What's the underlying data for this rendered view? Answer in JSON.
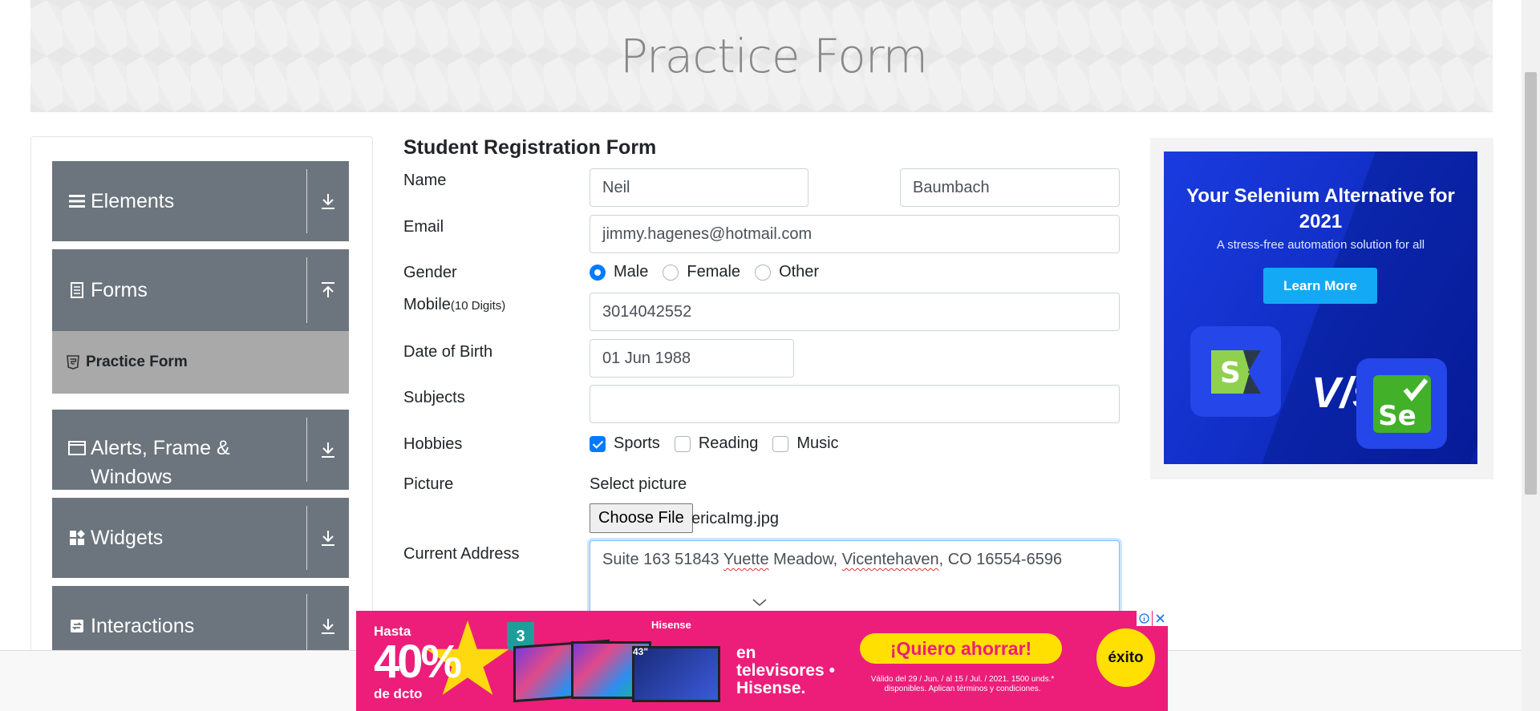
{
  "header": {
    "title": "Practice Form"
  },
  "sidebar": {
    "groups": [
      {
        "label": "Elements",
        "icon": "hamburger-icon",
        "arrow": "download-arrow-icon"
      },
      {
        "label": "Forms",
        "icon": "form-icon",
        "arrow": "upload-arrow-icon"
      },
      {
        "label": "Alerts, Frame &",
        "label2": "Windows",
        "icon": "window-icon",
        "arrow": "download-arrow-icon"
      },
      {
        "label": "Widgets",
        "icon": "widgets-icon",
        "arrow": "download-arrow-icon"
      },
      {
        "label": "Interactions",
        "icon": "interactions-icon",
        "arrow": "download-arrow-icon"
      }
    ],
    "active_item": {
      "label": "Practice Form",
      "icon": "html5-icon"
    }
  },
  "form": {
    "title": "Student Registration Form",
    "name_label": "Name",
    "first_name": "Neil",
    "last_name": "Baumbach",
    "email_label": "Email",
    "email": "jimmy.hagenes@hotmail.com",
    "gender_label": "Gender",
    "gender_options": [
      "Male",
      "Female",
      "Other"
    ],
    "gender_selected": "Male",
    "mobile_label": "Mobile",
    "mobile_hint": "(10 Digits)",
    "mobile": "3014042552",
    "dob_label": "Date of Birth",
    "dob": "01 Jun 1988",
    "subjects_label": "Subjects",
    "subjects": "",
    "hobbies_label": "Hobbies",
    "hobbies": [
      "Sports",
      "Reading",
      "Music"
    ],
    "hobbies_checked": [
      "Sports"
    ],
    "picture_label": "Picture",
    "select_picture": "Select picture",
    "choose_file": "Choose File",
    "file_name": "ericaImg.jpg",
    "address_label": "Current Address",
    "address_parts": [
      "Suite 163 51843 ",
      "Yuette",
      " Meadow, ",
      "Vicentehaven",
      ", CO 16554-6596"
    ]
  },
  "ad": {
    "headline": "Your Selenium Alternative for 2021",
    "subtext": "A stress-free automation solution for all",
    "button": "Learn More",
    "vs": "V/s",
    "logo_left": "S",
    "logo_right": "Se"
  },
  "bottom_ad": {
    "hasta": "Hasta",
    "percent": "40%",
    "de_dcto": "de dcto",
    "garantia": "3",
    "brand": "Hisense",
    "screen_size": "43\"",
    "text": "en televisores • Hisense.",
    "cta": "¡Quiero ahorrar!",
    "legal": "Válido del 29 / Jun. / al 15 / Jul. / 2021. 1500 unds.* disponibles. Aplican términos y condiciones.",
    "logo": "éxito"
  },
  "colors": {
    "sidebar_group": "#6c757d",
    "active_item": "#a9a9a9",
    "primary": "#007bff",
    "ad_blue": "#1a3be0",
    "ad_pink": "#ec1e79",
    "ad_yellow": "#ffe000"
  }
}
